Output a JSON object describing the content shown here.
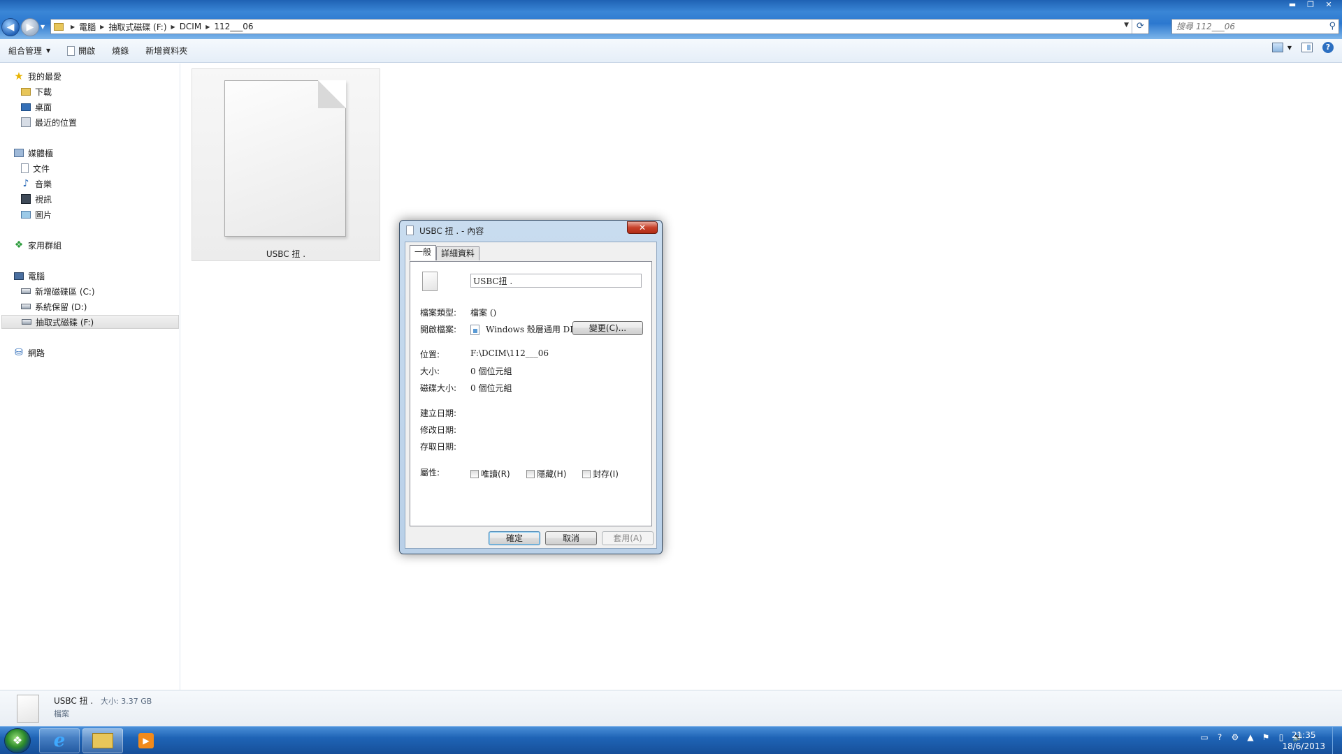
{
  "window": {
    "controls": {
      "minimize": "▬",
      "maximize": "❐",
      "close": "✕"
    }
  },
  "address_bar": {
    "breadcrumbs": [
      "電腦",
      "抽取式磁碟 (F:)",
      "DCIM",
      "112___06"
    ],
    "search_placeholder": "搜尋 112___06"
  },
  "command_bar": {
    "organize": "組合管理",
    "open": "開啟",
    "burn": "燒錄",
    "new_folder": "新增資料夾"
  },
  "nav_pane": {
    "favorites": {
      "label": "我的最愛",
      "items": [
        "下載",
        "桌面",
        "最近的位置"
      ]
    },
    "libraries": {
      "label": "媒體櫃",
      "items": [
        "文件",
        "音樂",
        "視訊",
        "圖片"
      ]
    },
    "homegroup": "家用群組",
    "computer": {
      "label": "電腦",
      "items": [
        "新增磁碟區 (C:)",
        "系統保留 (D:)",
        "抽取式磁碟 (F:)"
      ]
    },
    "network": "網路"
  },
  "file": {
    "name": "USBC  扭 ."
  },
  "details_pane": {
    "name": "USBC  扭 .",
    "size": "大小: 3.37 GB",
    "type": "檔案"
  },
  "taskbar": {
    "time": "21:35",
    "date": "18/6/2013",
    "tray_icons": [
      "▭",
      "?",
      "⚙",
      "▲",
      "⚑",
      "▯",
      "🔊"
    ]
  },
  "dialog": {
    "title": "USBC  扭 . - 內容",
    "close": "✕",
    "tabs": [
      "一般",
      "詳細資料"
    ],
    "file_name": "USBC扭 .",
    "type_label": "檔案類型:",
    "type_value": "檔案 ()",
    "opens_label": "開啟檔案:",
    "opens_value": "Windows 殼層通用 DI",
    "change_button": "變更(C)...",
    "location_label": "位置:",
    "location_value": "F:\\DCIM\\112___06",
    "size_label": "大小:",
    "size_value": "0 個位元組",
    "disk_size_label": "磁碟大小:",
    "disk_size_value": "0 個位元組",
    "created_label": "建立日期:",
    "modified_label": "修改日期:",
    "accessed_label": "存取日期:",
    "attributes_label": "屬性:",
    "attr_readonly": "唯讀(R)",
    "attr_hidden": "隱藏(H)",
    "attr_archive": "封存(I)",
    "ok": "確定",
    "cancel": "取消",
    "apply": "套用(A)"
  }
}
